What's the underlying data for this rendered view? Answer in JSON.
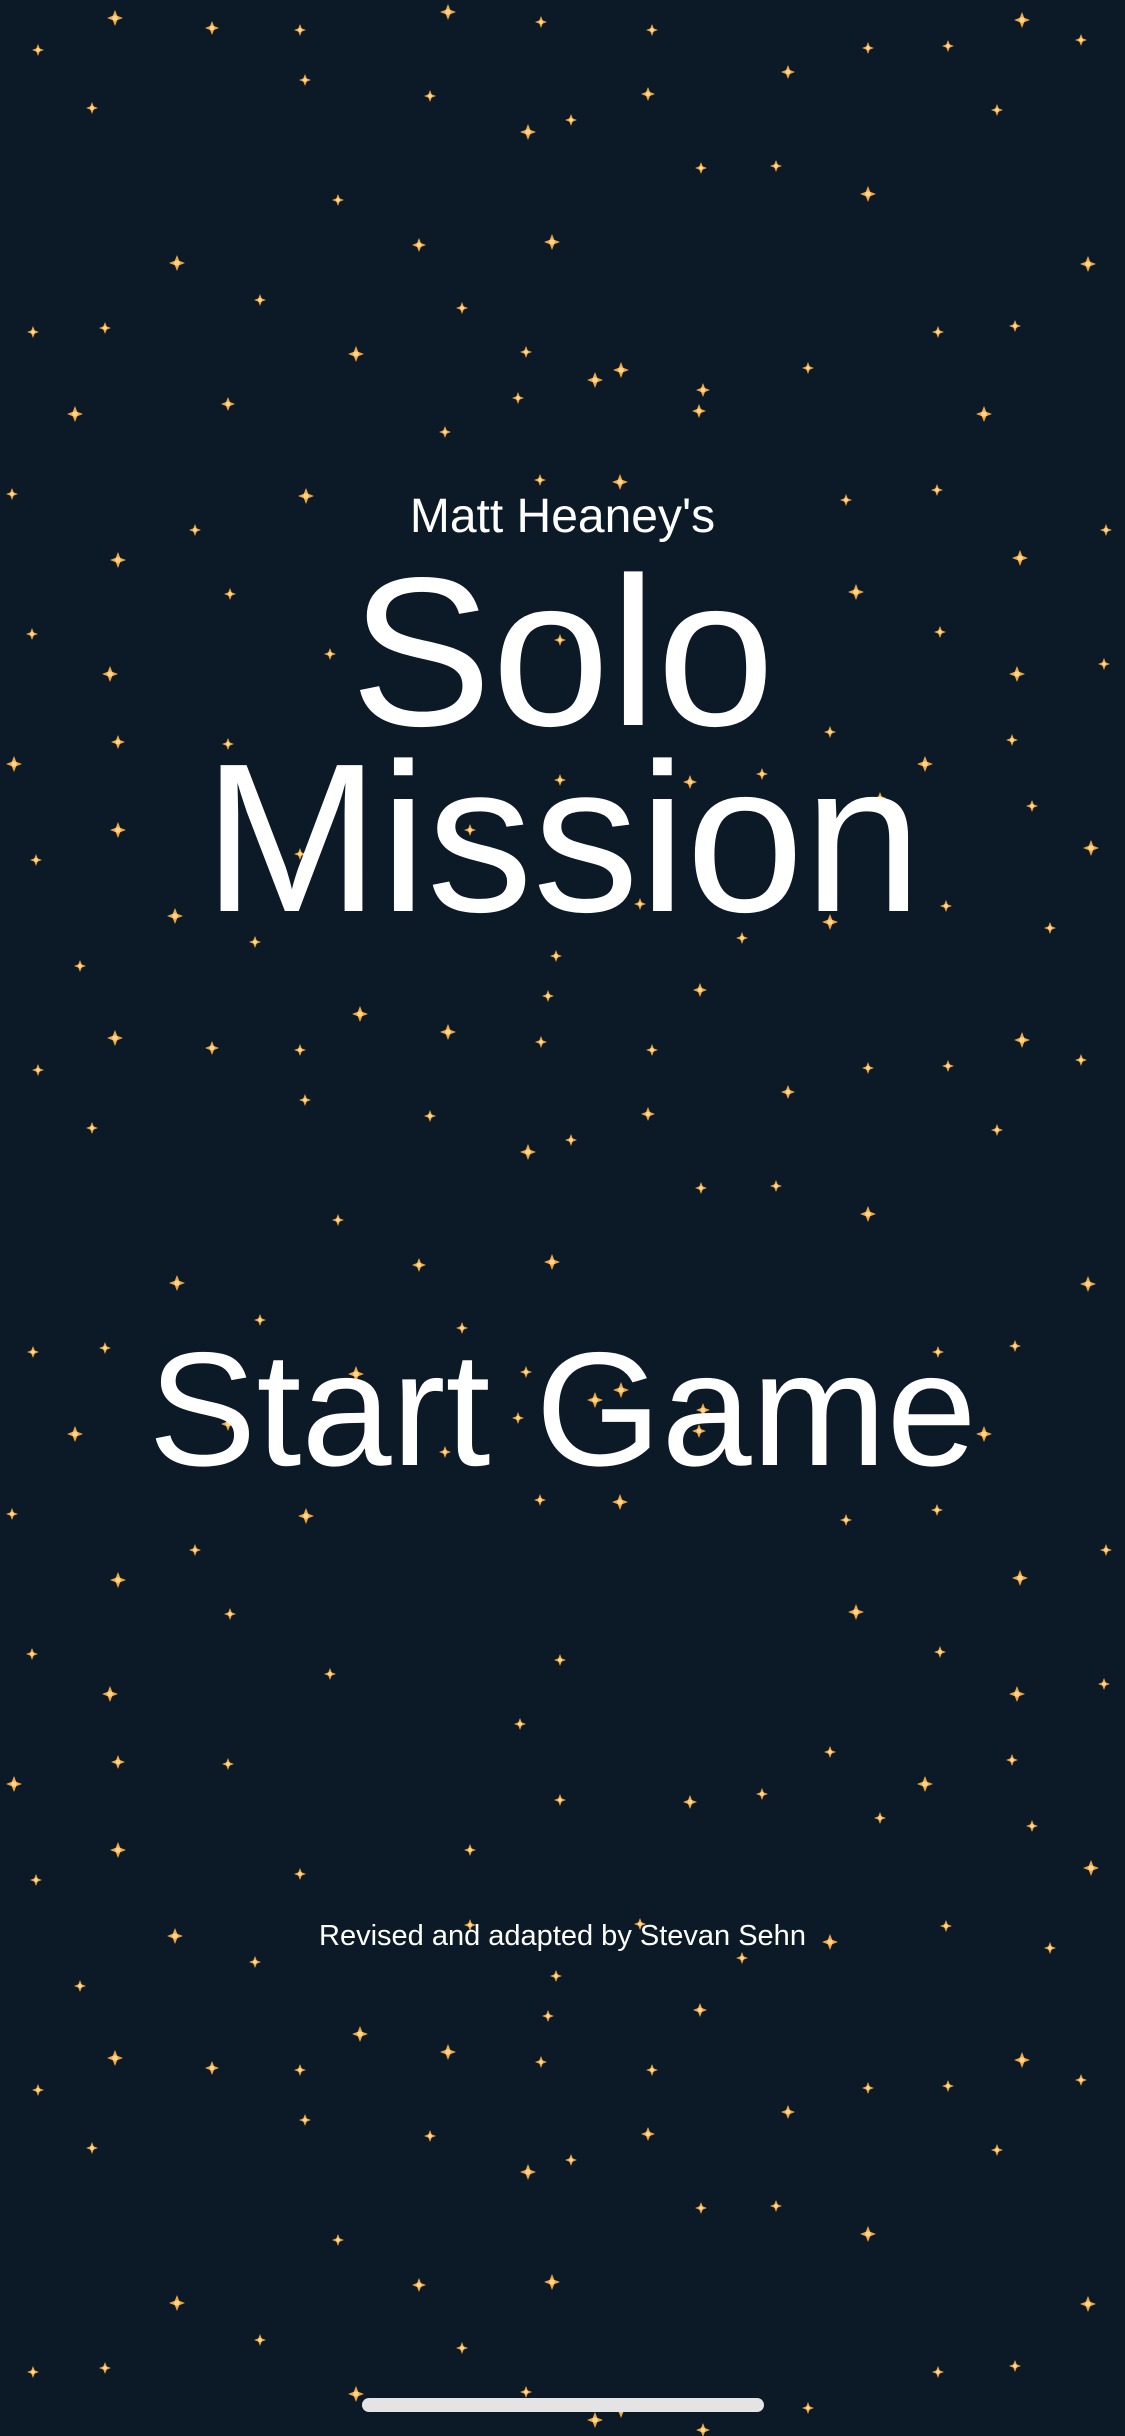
{
  "screen": {
    "background_color": "#0b1a26",
    "star_color": "#f0a742",
    "text_color": "#ffffff"
  },
  "title": {
    "author": "Matt Heaney's",
    "line1": "Solo",
    "line2": "Mission"
  },
  "menu": {
    "start_label": "Start Game"
  },
  "footer": {
    "credit": "Revised and adapted by Stevan Sehn"
  }
}
